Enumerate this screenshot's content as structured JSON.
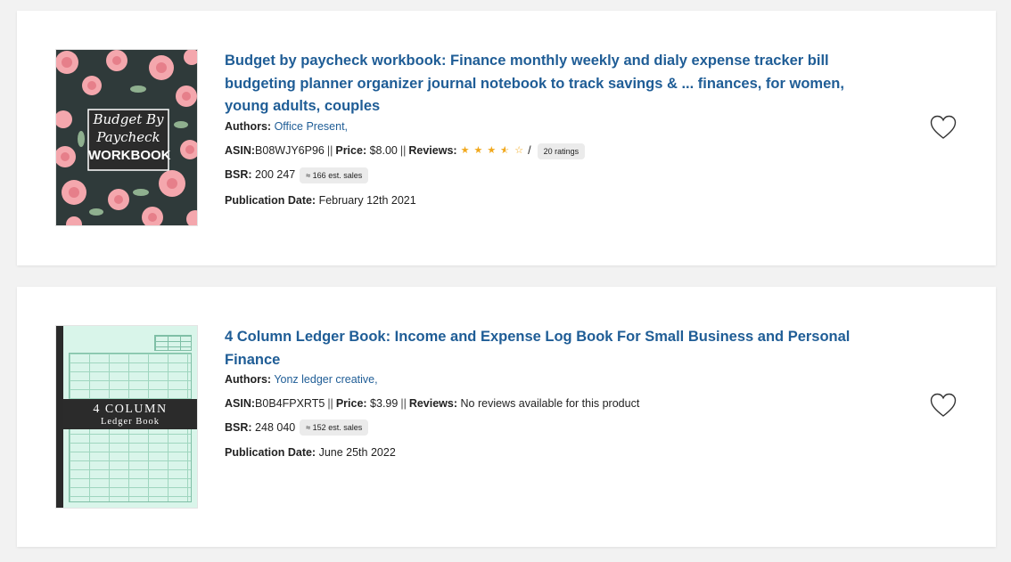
{
  "products": [
    {
      "title": "Budget by paycheck workbook: Finance monthly weekly and dialy expense tracker bill budgeting planner organizer journal notebook to track savings & ... finances, for women, young adults, couples",
      "cover": {
        "line1": "Budget By",
        "line2": "Paycheck",
        "line3": "WORKBOOK"
      },
      "authors_label": "Authors:",
      "authors": "Office Present,",
      "asin_label": "ASIN:",
      "asin": "B08WJY6P96",
      "price_label": "Price:",
      "price": "$8.00",
      "reviews_label": "Reviews:",
      "rating": 3.5,
      "rating_slash": "/",
      "ratings_count": "20 ratings",
      "separator": "||",
      "bsr_label": "BSR:",
      "bsr": "200 247",
      "est_sales": "≈ 166 est. sales",
      "pub_label": "Publication Date:",
      "pub_date": "February 12th 2021"
    },
    {
      "title": "4 Column Ledger Book: Income and Expense Log Book For Small Business and Personal Finance",
      "cover": {
        "line1": "4 COLUMN",
        "line2": "Ledger Book"
      },
      "authors_label": "Authors:",
      "authors": "Yonz ledger creative,",
      "asin_label": "ASIN:",
      "asin": "B0B4FPXRT5",
      "price_label": "Price:",
      "price": "$3.99",
      "reviews_label": "Reviews:",
      "reviews_text": "No reviews available for this product",
      "separator": "||",
      "bsr_label": "BSR:",
      "bsr": "248 040",
      "est_sales": "≈ 152 est. sales",
      "pub_label": "Publication Date:",
      "pub_date": "June 25th 2022"
    }
  ],
  "colors": {
    "title": "#1f5d96",
    "star": "#f1a81c",
    "pill_bg": "#ebebeb"
  },
  "icons": {
    "favorite": "heart-outline-icon",
    "star_full": "star-icon",
    "star_half": "star-half-icon",
    "star_empty": "star-empty-icon"
  }
}
